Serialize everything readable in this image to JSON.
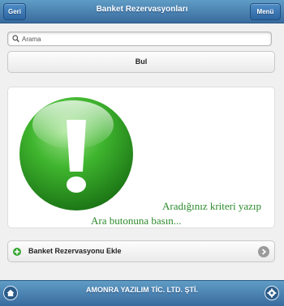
{
  "header": {
    "title": "Banket Rezervasyonları",
    "back_label": "Geri",
    "menu_label": "Menü"
  },
  "search": {
    "placeholder": "Arama",
    "value": ""
  },
  "search_button": {
    "label": "Bul"
  },
  "result_panel": {
    "icon": "exclamation-icon",
    "message_line1": "Aradığınız kriteri yazıp",
    "message_line2": "Ara butonuna basın..."
  },
  "add_button": {
    "label": "Banket Rezervasyonu Ekle",
    "left_icon": "plus-circle-icon",
    "right_icon": "arrow-right-circle-icon"
  },
  "footer": {
    "title": "AMONRA YAZILIM TİC. LTD. ŞTİ.",
    "left_icon": "home-icon",
    "right_icon": "gear-icon"
  },
  "colors": {
    "header_bar": "#4a83b8",
    "accent_green": "#2c8a2c",
    "background": "#f0f0f0"
  }
}
